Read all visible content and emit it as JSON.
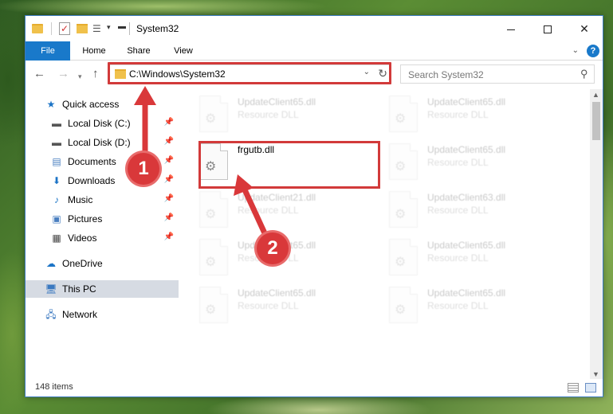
{
  "window": {
    "title": "System32",
    "minimize_glyph": "",
    "close_glyph": "✕"
  },
  "ribbon": {
    "tabs": [
      "File",
      "Home",
      "Share",
      "View"
    ],
    "help": "?"
  },
  "address": {
    "path": "C:\\Windows\\System32"
  },
  "search": {
    "placeholder": "Search System32"
  },
  "sidebar": {
    "items": [
      {
        "label": "Quick access",
        "icon": "star-icon",
        "pinned": false
      },
      {
        "label": "Local Disk (C:)",
        "icon": "drive-icon",
        "pinned": true
      },
      {
        "label": "Local Disk (D:)",
        "icon": "drive-icon",
        "pinned": true
      },
      {
        "label": "Documents",
        "icon": "documents-icon",
        "pinned": true
      },
      {
        "label": "Downloads",
        "icon": "download-icon",
        "pinned": true
      },
      {
        "label": "Music",
        "icon": "music-icon",
        "pinned": true
      },
      {
        "label": "Pictures",
        "icon": "pictures-icon",
        "pinned": true
      },
      {
        "label": "Videos",
        "icon": "videos-icon",
        "pinned": true
      },
      {
        "label": "OneDrive",
        "icon": "cloud-icon",
        "pinned": false
      },
      {
        "label": "This PC",
        "icon": "computer-icon",
        "pinned": false
      },
      {
        "label": "Network",
        "icon": "network-icon",
        "pinned": false
      }
    ]
  },
  "files": [
    {
      "name": "UpdateClient65.dll",
      "type": "Resource DLL",
      "faded": true
    },
    {
      "name": "UpdateClient65.dll",
      "type": "Resource DLL",
      "faded": true
    },
    {
      "name": "frgutb.dll",
      "type": "",
      "faded": false
    },
    {
      "name": "UpdateClient65.dll",
      "type": "Resource DLL",
      "faded": true
    },
    {
      "name": "UpdateClient21.dll",
      "type": "Resource DLL",
      "faded": true
    },
    {
      "name": "UpdateClient63.dll",
      "type": "Resource DLL",
      "faded": true
    },
    {
      "name": "UpdateClient65.dll",
      "type": "Resource DLL",
      "faded": true
    },
    {
      "name": "UpdateClient65.dll",
      "type": "Resource DLL",
      "faded": true
    },
    {
      "name": "UpdateClient65.dll",
      "type": "Resource DLL",
      "faded": true
    },
    {
      "name": "UpdateClient65.dll",
      "type": "Resource DLL",
      "faded": true
    }
  ],
  "status": {
    "item_count": "148 items"
  },
  "annotations": {
    "step1": "1",
    "step2": "2",
    "color": "#d9383a"
  }
}
